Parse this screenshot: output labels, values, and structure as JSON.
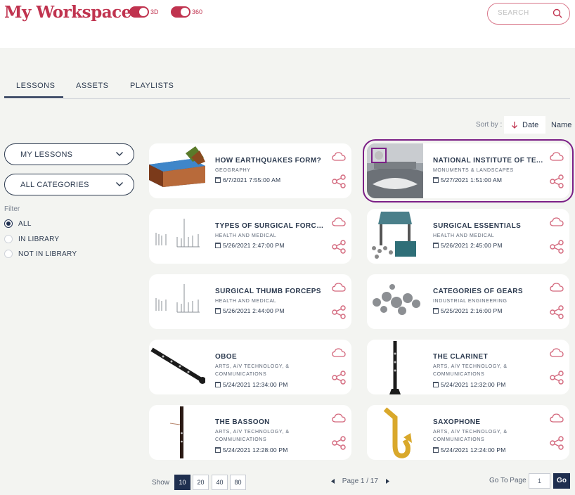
{
  "header": {
    "title": "My Workspace",
    "toggles": [
      {
        "label": "3D",
        "on": true
      },
      {
        "label": "360",
        "on": true
      }
    ],
    "search": {
      "placeholder": "SEARCH"
    }
  },
  "tabs": [
    {
      "label": "LESSONS",
      "active": true
    },
    {
      "label": "ASSETS"
    },
    {
      "label": "PLAYLISTS"
    }
  ],
  "sort": {
    "label": "Sort by :",
    "options": [
      {
        "label": "Date",
        "active": true,
        "icon": "arrow-down-icon"
      },
      {
        "label": "Name"
      }
    ]
  },
  "sidebar": {
    "dropdowns": [
      {
        "label": "MY LESSONS"
      },
      {
        "label": "ALL CATEGORIES"
      }
    ],
    "filter_title": "Filter",
    "filters": [
      {
        "label": "ALL",
        "selected": true
      },
      {
        "label": "IN LIBRARY"
      },
      {
        "label": "NOT IN LIBRARY"
      }
    ]
  },
  "lessons": [
    {
      "title": "HOW EARTHQUAKES FORM?",
      "category": "GEOGRAPHY",
      "date": "6/7/2021 7:55:00 AM",
      "thumb": "earth-crust"
    },
    {
      "title": "NATIONAL INSTITUTE OF TE...",
      "category": "MONUMENTS & LANDSCAPES",
      "date": "5/27/2021 1:51:00 AM",
      "thumb": "panorama",
      "selected": true
    },
    {
      "title": "TYPES OF SURGICAL FORCEPS",
      "category": "HEALTH AND MEDICAL",
      "date": "5/26/2021 2:47:00 PM",
      "thumb": "forceps"
    },
    {
      "title": "SURGICAL ESSENTIALS",
      "category": "HEALTH AND MEDICAL",
      "date": "5/26/2021 2:45:00 PM",
      "thumb": "surgical-kit"
    },
    {
      "title": "SURGICAL THUMB FORCEPS",
      "category": "HEALTH AND MEDICAL",
      "date": "5/26/2021 2:44:00 PM",
      "thumb": "forceps"
    },
    {
      "title": "CATEGORIES OF GEARS",
      "category": "INDUSTRIAL ENGINEERING",
      "date": "5/25/2021 2:16:00 PM",
      "thumb": "gears"
    },
    {
      "title": "OBOE",
      "category": "ARTS, A/V TECHNOLOGY, & COMMUNICATIONS",
      "date": "5/24/2021 12:34:00 PM",
      "thumb": "oboe"
    },
    {
      "title": "THE CLARINET",
      "category": "ARTS, A/V TECHNOLOGY, & COMMUNICATIONS",
      "date": "5/24/2021 12:32:00 PM",
      "thumb": "clarinet"
    },
    {
      "title": "THE BASSOON",
      "category": "ARTS, A/V TECHNOLOGY, & COMMUNICATIONS",
      "date": "5/24/2021 12:28:00 PM",
      "thumb": "bassoon"
    },
    {
      "title": "SAXOPHONE",
      "category": "ARTS, A/V TECHNOLOGY, & COMMUNICATIONS",
      "date": "5/24/2021 12:24:00 PM",
      "thumb": "saxophone"
    }
  ],
  "pagination": {
    "show_label": "Show",
    "sizes": [
      "10",
      "20",
      "40",
      "80"
    ],
    "active_size": "10",
    "page_text": "Page 1 / 17",
    "goto_label": "Go To Page",
    "goto_value": "1",
    "go_label": "Go"
  },
  "colors": {
    "brand": "#c0334f",
    "navy": "#1f2f4f",
    "selection": "#7b1f86"
  }
}
